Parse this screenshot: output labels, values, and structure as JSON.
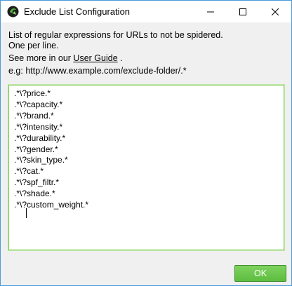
{
  "window": {
    "title": "Exclude List Configuration",
    "icon": "zap-app-icon",
    "controls": {
      "minimize": "minimize-icon",
      "maximize": "maximize-icon",
      "close": "close-icon"
    }
  },
  "description": {
    "line1": "List of regular expressions for URLs to not be spidered.",
    "line2": "One per line.",
    "line3_prefix": "See more in our ",
    "line3_link": "User Guide",
    "line3_suffix": " .",
    "line4": "e.g: http://www.example.com/exclude-folder/.*"
  },
  "editor": {
    "lines": [
      ".*\\?price.*",
      ".*\\?capacity.*",
      ".*\\?brand.*",
      ".*\\?intensity.*",
      ".*\\?durability.*",
      ".*\\?gender.*",
      ".*\\?skin_type.*",
      ".*\\?cat.*",
      ".*\\?spf_filtr.*",
      ".*\\?shade.*",
      ".*\\?custom_weight.*"
    ]
  },
  "buttons": {
    "ok_label": "OK"
  },
  "colors": {
    "accent_green": "#5dbd3f",
    "border_green": "#7fcf5a",
    "window_border": "#4a9bd8"
  }
}
